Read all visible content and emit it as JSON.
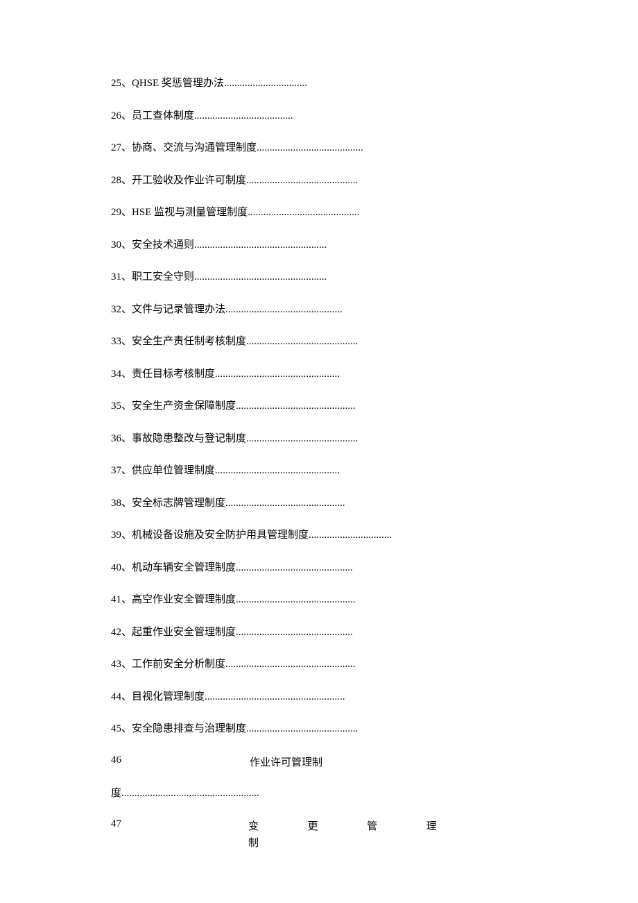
{
  "toc": {
    "items": [
      {
        "num": "25、",
        "title": "QHSE 奖惩管理办法",
        "dots": "................................"
      },
      {
        "num": "26、",
        "title": "员工查体制度",
        "dots": "......................................"
      },
      {
        "num": "27、",
        "title": "协商、交流与沟通管理制度",
        "dots": "........................................."
      },
      {
        "num": "28、",
        "title": "开工验收及作业许可制度",
        "dots": "..........................................."
      },
      {
        "num": "29、",
        "title": "HSE 监视与测量管理制度",
        "dots": "..........................................."
      },
      {
        "num": "30、",
        "title": "安全技术通则",
        "dots": "..................................................."
      },
      {
        "num": "31、",
        "title": "职工安全守则",
        "dots": "..................................................."
      },
      {
        "num": "32、",
        "title": "文件与记录管理办法",
        "dots": "............................................."
      },
      {
        "num": "33、",
        "title": "安全生产责任制考核制度",
        "dots": "..........................................."
      },
      {
        "num": "34、",
        "title": "责任目标考核制度",
        "dots": "................................................"
      },
      {
        "num": "35、",
        "title": "安全生产资金保障制度",
        "dots": ".............................................."
      },
      {
        "num": "36、",
        "title": "事故隐患整改与登记制度",
        "dots": "..........................................."
      },
      {
        "num": "37、",
        "title": "供应单位管理制度",
        "dots": "................................................"
      },
      {
        "num": "38、",
        "title": "安全标志牌管理制度",
        "dots": ".............................................."
      },
      {
        "num": "39、",
        "title": "机械设备设施及安全防护用具管理制度",
        "dots": "................................"
      },
      {
        "num": "40、",
        "title": "机动车辆安全管理制度",
        "dots": "............................................."
      },
      {
        "num": "41、",
        "title": "高空作业安全管理制度",
        "dots": ".............................................."
      },
      {
        "num": "42、",
        "title": "起重作业安全管理制度",
        "dots": "............................................."
      },
      {
        "num": "43、",
        "title": "工作前安全分析制度",
        "dots": ".................................................."
      },
      {
        "num": "44、",
        "title": "目视化管理制度",
        "dots": "......................................................"
      },
      {
        "num": "45、",
        "title": "安全隐患排查与治理制度",
        "dots": "..........................................."
      }
    ],
    "item46": {
      "num": "46",
      "title": "作业许可管理制",
      "cont": "度",
      "dots": "....................................................."
    },
    "item47": {
      "num": "47",
      "c1": "变",
      "c2": "更",
      "c3": "管",
      "c4": "理",
      "c5": "制"
    }
  }
}
